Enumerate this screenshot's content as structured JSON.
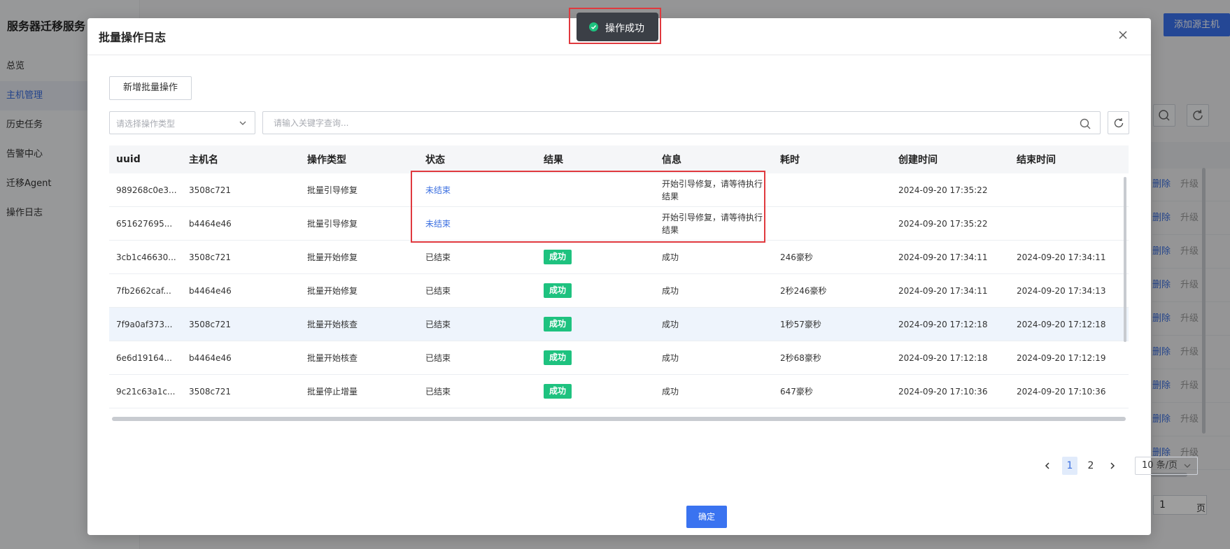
{
  "app": {
    "name": "服务器迁移服务",
    "nav": [
      "总览",
      "主机管理",
      "历史任务",
      "告警中心",
      "迁移Agent",
      "操作日志"
    ],
    "active_nav": 1,
    "add_host_label": "添加源主机",
    "row_delete_label": "删除",
    "row_upgrade_label": "升级",
    "page_input_value": "1",
    "page_label": "页"
  },
  "toast": {
    "text": "操作成功",
    "icon": "check-circle-icon"
  },
  "modal": {
    "title": "批量操作日志",
    "add_button": "新增批量操作",
    "type_select_placeholder": "请选择操作类型",
    "search_placeholder": "请输入关键字查询...",
    "ok_button": "确定"
  },
  "table": {
    "headers": [
      "uuid",
      "主机名",
      "操作类型",
      "状态",
      "结果",
      "信息",
      "耗时",
      "创建时间",
      "结束时间"
    ],
    "rows": [
      {
        "uuid": "989268c0e3...",
        "host": "3508c721",
        "op": "批量引导修复",
        "status": "未结束",
        "result": "",
        "info": "开始引导修复，请等待执行结果",
        "duration": "",
        "created": "2024-09-20 17:35:22",
        "ended": ""
      },
      {
        "uuid": "651627695...",
        "host": "b4464e46",
        "op": "批量引导修复",
        "status": "未结束",
        "result": "",
        "info": "开始引导修复，请等待执行结果",
        "duration": "",
        "created": "2024-09-20 17:35:22",
        "ended": ""
      },
      {
        "uuid": "3cb1c46630...",
        "host": "3508c721",
        "op": "批量开始修复",
        "status": "已结束",
        "result": "成功",
        "info": "成功",
        "duration": "246豪秒",
        "created": "2024-09-20 17:34:11",
        "ended": "2024-09-20 17:34:11"
      },
      {
        "uuid": "7fb2662caf...",
        "host": "b4464e46",
        "op": "批量开始修复",
        "status": "已结束",
        "result": "成功",
        "info": "成功",
        "duration": "2秒246豪秒",
        "created": "2024-09-20 17:34:11",
        "ended": "2024-09-20 17:34:13"
      },
      {
        "uuid": "7f9a0af373...",
        "host": "3508c721",
        "op": "批量开始核查",
        "status": "已结束",
        "result": "成功",
        "info": "成功",
        "duration": "1秒57豪秒",
        "created": "2024-09-20 17:12:18",
        "ended": "2024-09-20 17:12:18"
      },
      {
        "uuid": "6e6d19164...",
        "host": "b4464e46",
        "op": "批量开始核查",
        "status": "已结束",
        "result": "成功",
        "info": "成功",
        "duration": "2秒68豪秒",
        "created": "2024-09-20 17:12:18",
        "ended": "2024-09-20 17:12:19"
      },
      {
        "uuid": "9c21c63a1c...",
        "host": "3508c721",
        "op": "批量停止增量",
        "status": "已结束",
        "result": "成功",
        "info": "成功",
        "duration": "647豪秒",
        "created": "2024-09-20 17:10:36",
        "ended": "2024-09-20 17:10:36"
      }
    ]
  },
  "pagination": {
    "pages": [
      "1",
      "2"
    ],
    "current": "1",
    "page_size": "10 条/页"
  },
  "colors": {
    "accent": "#3a73f0",
    "success": "#1ec27f",
    "annotation": "#e0393e"
  }
}
